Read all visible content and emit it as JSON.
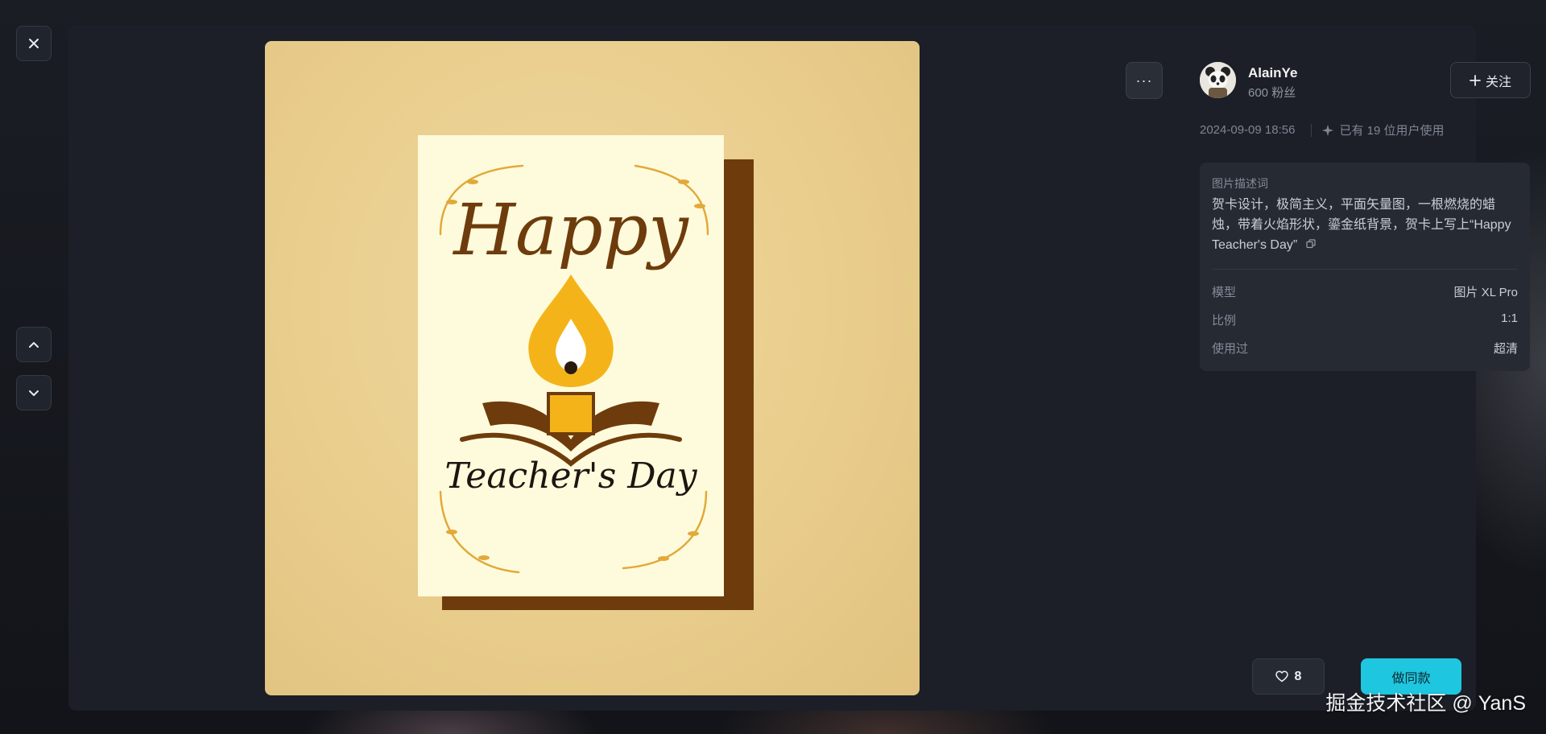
{
  "author": {
    "name": "AlainYe",
    "fans": "600 粉丝"
  },
  "follow_label": "关注",
  "meta": {
    "datetime": "2024-09-09 18:56",
    "usage": "已有 19 位用户使用"
  },
  "prompt": {
    "label": "图片描述词",
    "text": "贺卡设计，极简主义，平面矢量图，一根燃烧的蜡烛，带着火焰形状，鎏金纸背景，贺卡上写上“Happy Teacher's Day”"
  },
  "details": [
    {
      "key": "模型",
      "value": "图片 XL Pro"
    },
    {
      "key": "比例",
      "value": "1:1"
    },
    {
      "key": "使用过",
      "value": "超清"
    }
  ],
  "image": {
    "card_word_1": "Happy",
    "card_word_2": "Teacher's Day"
  },
  "more_label": "···",
  "likes": "8",
  "make_same_label": "做同款",
  "watermark": "掘金技术社区 @ YanS",
  "icons": [
    "close-icon",
    "chevron-up-icon",
    "chevron-down-icon",
    "more-icon",
    "plus-icon",
    "sparkle-icon",
    "copy-icon",
    "heart-icon"
  ],
  "colors": {
    "accent": "#1ec6df",
    "modal_bg": "#1c1f27",
    "card_bg": "#262a33"
  }
}
